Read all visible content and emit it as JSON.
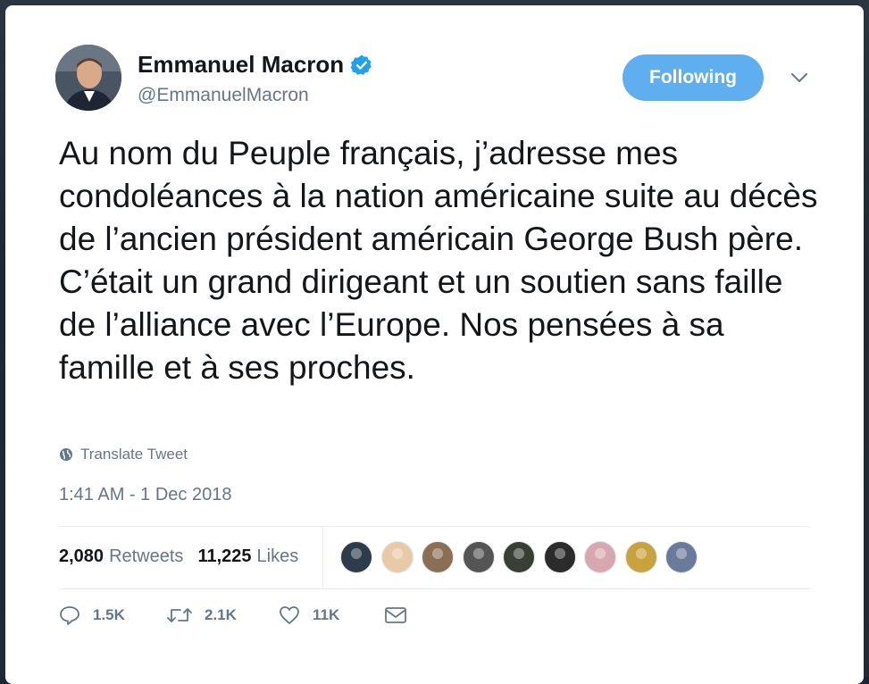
{
  "author": {
    "name": "Emmanuel Macron",
    "handle": "@EmmanuelMacron",
    "verified": true
  },
  "follow_button": {
    "label": "Following",
    "color": "#5eaef0"
  },
  "tweet": {
    "text": "Au nom du Peuple français, j’adresse mes condoléances à la nation américaine suite au décès de l’ancien président américain George Bush père. C’était un grand dirigeant et un soutien sans faille de l’alliance avec l’Europe. Nos pensées à sa famille et à ses proches.",
    "translate_label": "Translate Tweet",
    "timestamp": "1:41 AM - 1 Dec 2018"
  },
  "stats": {
    "retweets_count": "2,080",
    "retweets_label": "Retweets",
    "likes_count": "11,225",
    "likes_label": "Likes"
  },
  "likers": [
    {
      "name": "liker-avatar",
      "color": "#2d3b4a"
    },
    {
      "name": "liker-avatar",
      "color": "#e8c9a8"
    },
    {
      "name": "liker-avatar",
      "color": "#8a6f55"
    },
    {
      "name": "liker-avatar",
      "color": "#555555"
    },
    {
      "name": "liker-avatar",
      "color": "#3a3f33"
    },
    {
      "name": "liker-avatar",
      "color": "#2b2b2b"
    },
    {
      "name": "liker-avatar",
      "color": "#d8a7b0"
    },
    {
      "name": "liker-avatar",
      "color": "#c8a23c"
    },
    {
      "name": "liker-avatar",
      "color": "#6a7a9a"
    }
  ],
  "actions": {
    "reply_count": "1.5K",
    "retweet_count": "2.1K",
    "like_count": "11K"
  },
  "colors": {
    "text": "#14171a",
    "muted": "#657786",
    "verified": "#1da1f2"
  }
}
